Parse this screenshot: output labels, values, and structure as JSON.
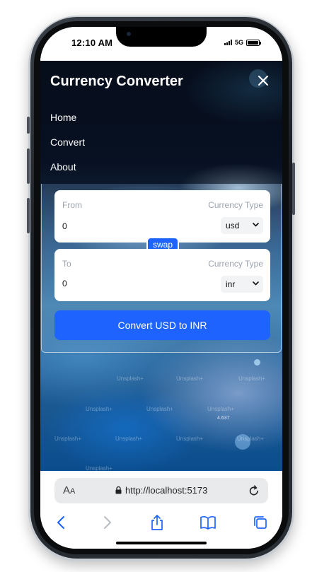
{
  "status_bar": {
    "time": "12:10 AM",
    "network": "5G"
  },
  "app": {
    "title": "Currency Converter"
  },
  "nav": {
    "links": [
      "Home",
      "Convert",
      "About"
    ]
  },
  "converter": {
    "from": {
      "label": "From",
      "currency_type_label": "Currency Type",
      "amount": "0",
      "currency": "usd"
    },
    "to": {
      "label": "To",
      "currency_type_label": "Currency Type",
      "amount": "0",
      "currency": "inr"
    },
    "swap_label": "swap",
    "convert_label": "Convert USD to INR"
  },
  "background": {
    "watermark": "Unsplash+",
    "number_label": "4.637"
  },
  "browser": {
    "aa_label": "A",
    "aa_small": "A",
    "url": "http://localhost:5173"
  },
  "colors": {
    "accent": "#1f63ff",
    "nav_overlay": "#060a14"
  },
  "icons": [
    "close-icon",
    "chevron-down-icon",
    "lock-icon",
    "reload-icon",
    "back-icon",
    "forward-icon",
    "share-icon",
    "bookmarks-icon",
    "tabs-icon"
  ]
}
